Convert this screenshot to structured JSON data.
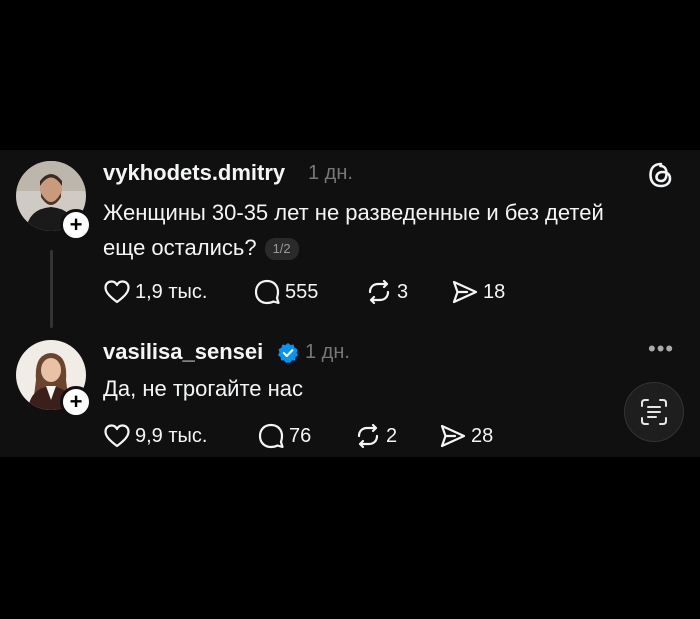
{
  "posts": [
    {
      "username": "vykhodets.dmitry",
      "time": "1 дн.",
      "text_line1": "Женщины 30-35 лет не разведенные и без детей",
      "text_line2": "еще остались?",
      "pager": "1/2",
      "likes": "1,9 тыс.",
      "replies": "555",
      "reposts": "3",
      "shares": "18",
      "avatar_icon": "man-avatar"
    },
    {
      "username": "vasilisa_sensei",
      "verified": true,
      "time": "1 дн.",
      "text_line1": "Да, не трогайте нас",
      "likes": "9,9 тыс.",
      "replies": "76",
      "reposts": "2",
      "shares": "28",
      "avatar_icon": "woman-avatar"
    }
  ],
  "icons": {
    "brand": "threads-logo",
    "more": "more-icon",
    "scan": "text-scan-icon"
  },
  "colors": {
    "background": "#000000",
    "panel": "#101010",
    "verified": "#0095f6",
    "muted": "#777777"
  }
}
